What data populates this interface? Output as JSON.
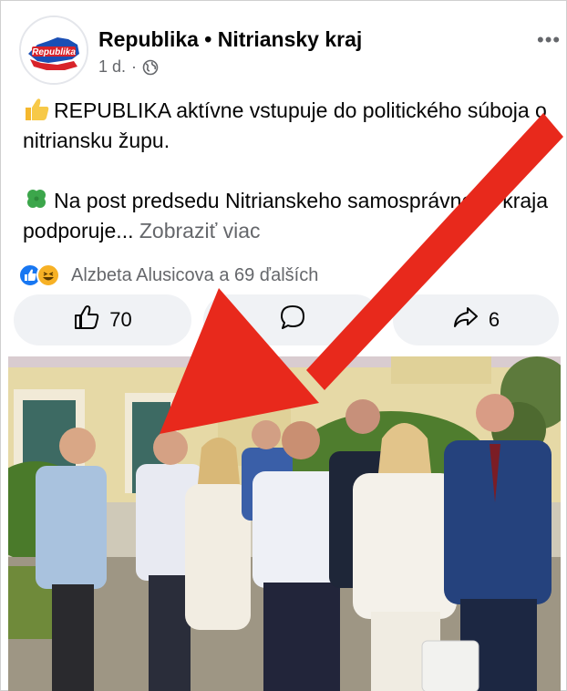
{
  "post": {
    "page_name": "Republika • Nitriansky kraj",
    "time": "1 d.",
    "separator": "·",
    "more": "•••",
    "avatar_logo_text": "Republika",
    "text_line1": "REPUBLIKA aktívne vstupuje do politického súboja o nitriansku župu.",
    "text_line2": "Na post predsedu Nitrianskeho samosprávneho kraja podporuje...",
    "see_more": "Zobraziť viac",
    "reactions_text": "Alzbeta Alusicova a 69 ďalších",
    "like_count": "70",
    "share_count": "6"
  },
  "icons": {
    "avatar": "republika-logo",
    "privacy": "globe-icon",
    "like": "thumbs-up-icon",
    "comment": "comment-bubble-icon",
    "share": "share-arrow-icon",
    "emoji1": "thumbs-up-emoji",
    "emoji2": "four-leaf-clover-emoji"
  },
  "colors": {
    "accent": "#1877f2",
    "haha": "#f7b125",
    "arrow": "#e8291c",
    "secondary_text": "#65676b",
    "button_bg": "#f0f2f5"
  }
}
